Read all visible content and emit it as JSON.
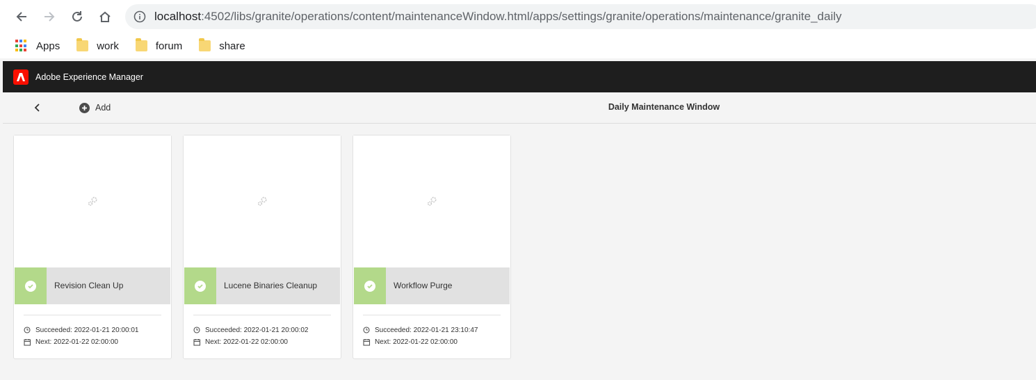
{
  "browser": {
    "url_host": "localhost",
    "url_rest": ":4502/libs/granite/operations/content/maintenanceWindow.html/apps/settings/granite/operations/maintenance/granite_daily"
  },
  "bookmarks": [
    {
      "label": "Apps",
      "icon": "apps-grid-icon"
    },
    {
      "label": "work",
      "icon": "folder-icon"
    },
    {
      "label": "forum",
      "icon": "folder-icon"
    },
    {
      "label": "share",
      "icon": "folder-icon"
    }
  ],
  "header": {
    "app_title": "Adobe Experience Manager"
  },
  "actionbar": {
    "add_label": "Add",
    "page_title": "Daily Maintenance Window"
  },
  "colors": {
    "header_bg": "#1e1e1e",
    "adobe_red": "#fa0f00",
    "status_success": "#b3d98a"
  },
  "cards": [
    {
      "title": "Revision Clean Up",
      "succeeded": "Succeeded: 2022-01-21 20:00:01",
      "next": "Next: 2022-01-22 02:00:00"
    },
    {
      "title": "Lucene Binaries Cleanup",
      "succeeded": "Succeeded: 2022-01-21 20:00:02",
      "next": "Next: 2022-01-22 02:00:00"
    },
    {
      "title": "Workflow Purge",
      "succeeded": "Succeeded: 2022-01-21 23:10:47",
      "next": "Next: 2022-01-22 02:00:00"
    }
  ]
}
